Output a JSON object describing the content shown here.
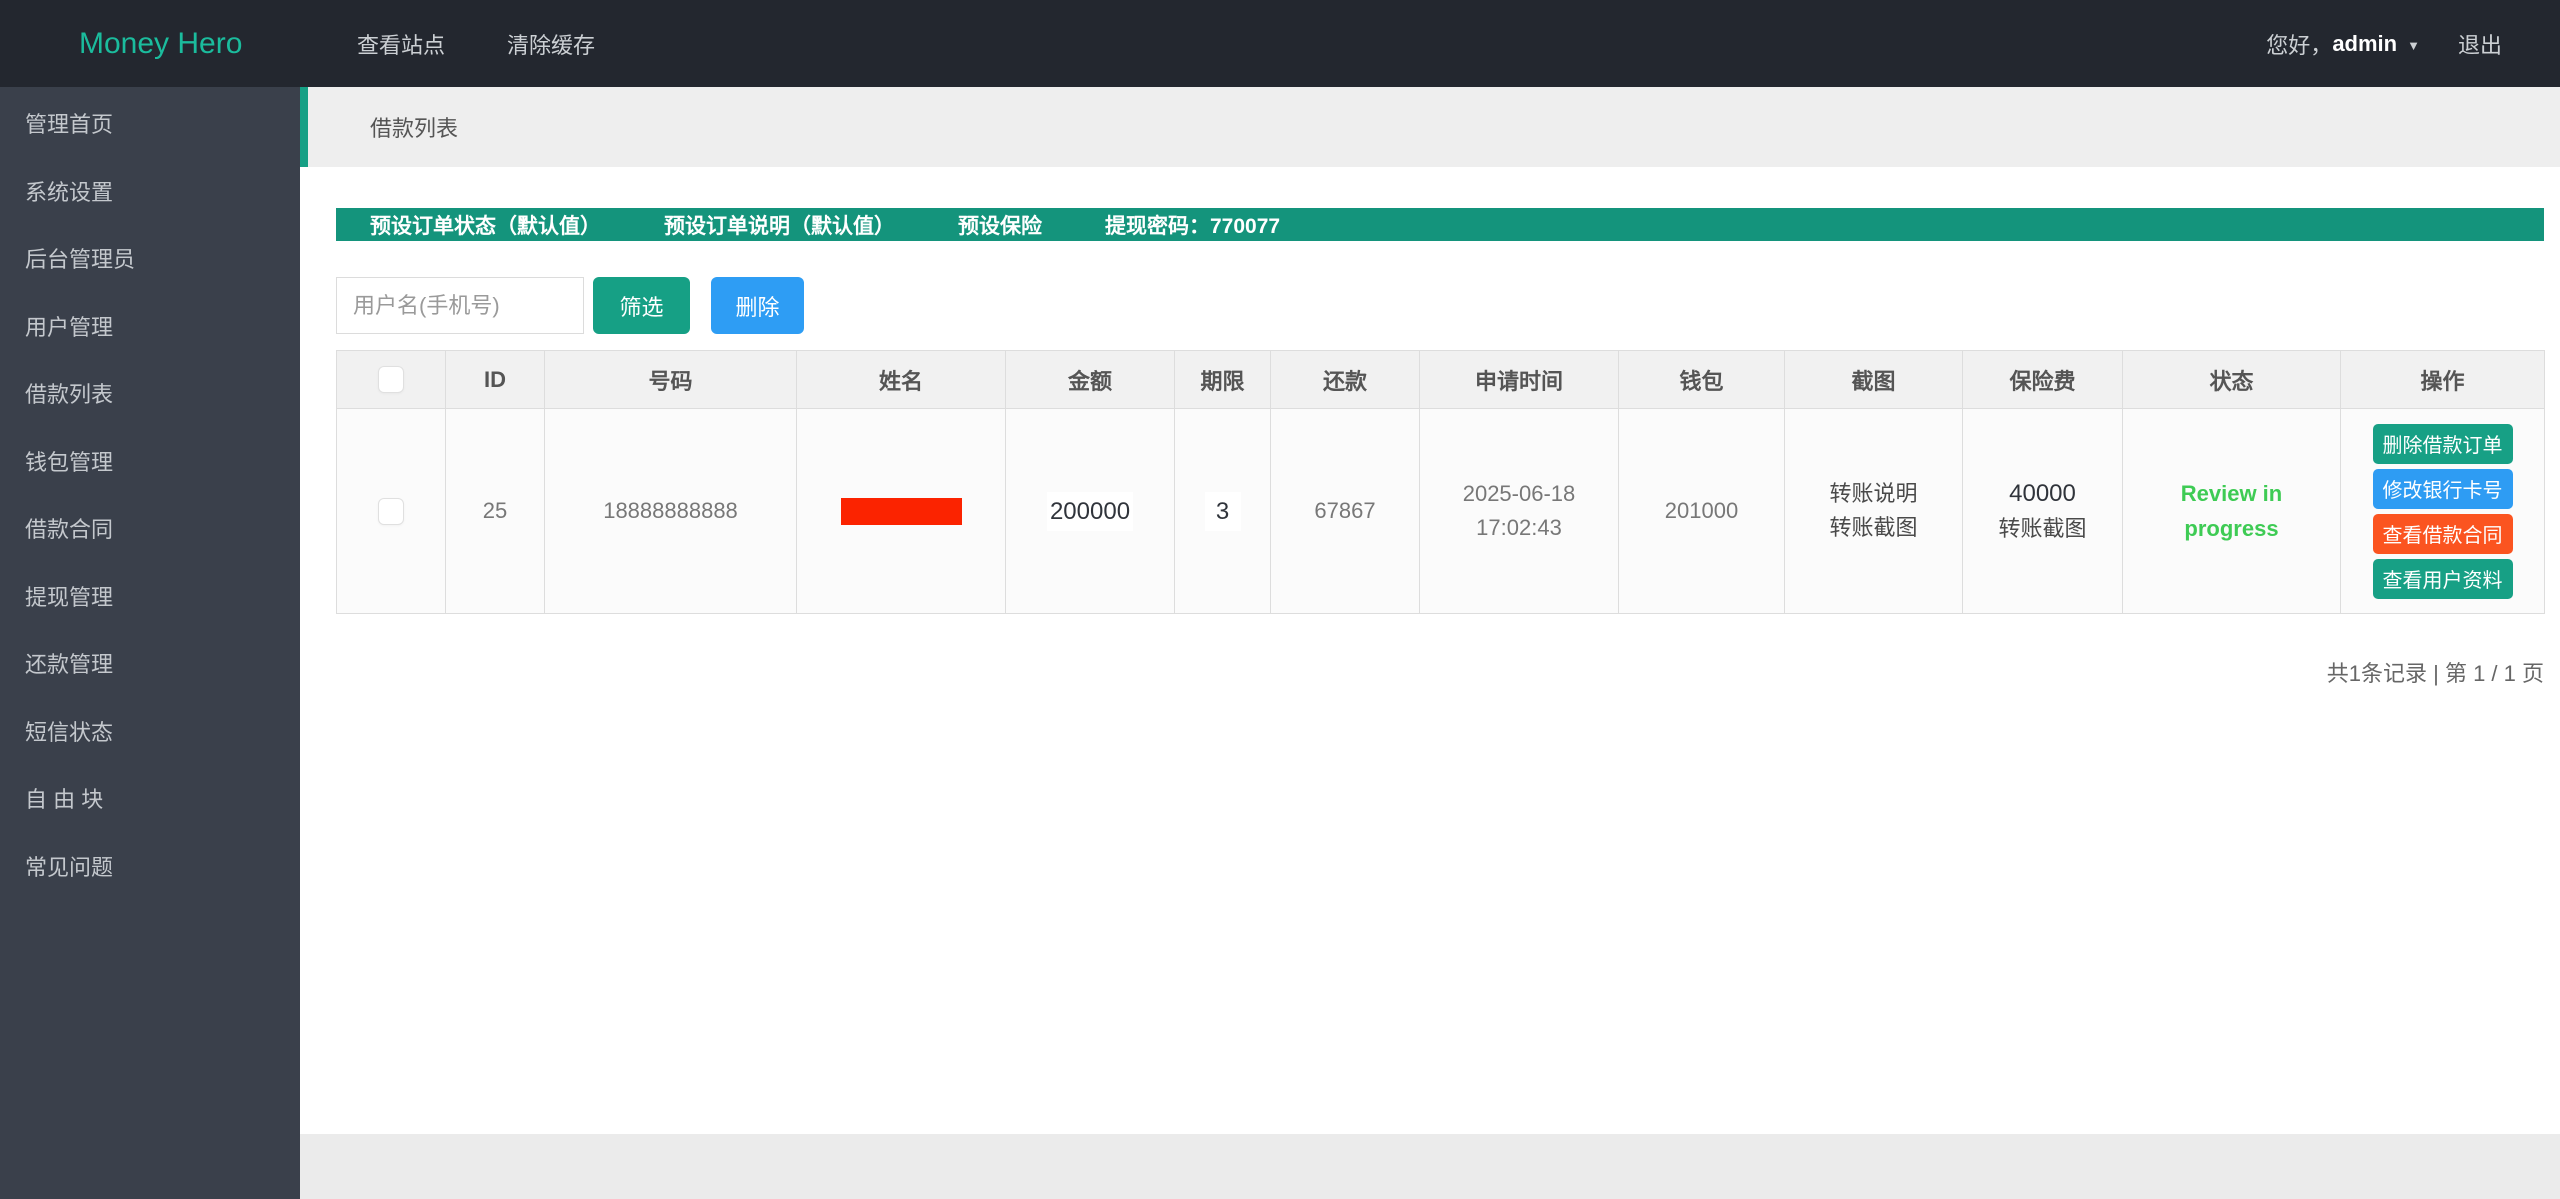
{
  "topbar": {
    "logo": "Money Hero",
    "menu": [
      {
        "label": "查看站点"
      },
      {
        "label": "清除缓存"
      }
    ],
    "greeting_prefix": "您好，",
    "username": "admin",
    "caret": "▼",
    "logout": "退出"
  },
  "sidebar": {
    "items": [
      "管理首页",
      "系统设置",
      "后台管理员",
      "用户管理",
      "借款列表",
      "钱包管理",
      "借款合同",
      "提现管理",
      "还款管理",
      "短信状态",
      "自 由 块",
      "常见问题"
    ]
  },
  "breadcrumb": {
    "title": "借款列表"
  },
  "presets": {
    "order_status": "预设订单状态（默认值）",
    "order_note": "预设订单说明（默认值）",
    "insurance": "预设保险",
    "withdraw_password": "提现密码：770077"
  },
  "search": {
    "placeholder": "用户名(手机号)",
    "filter_label": "筛选",
    "delete_label": "删除"
  },
  "table": {
    "headers": [
      "ID",
      "号码",
      "姓名",
      "金额",
      "期限",
      "还款",
      "申请时间",
      "钱包",
      "截图",
      "保险费",
      "状态",
      "操作"
    ],
    "row": {
      "id": "25",
      "phone": "18888888888",
      "amount": "200000",
      "term": "3",
      "repayment": "67867",
      "apply_date": "2025-06-18",
      "apply_time": "17:02:43",
      "wallet": "201000",
      "screenshot_link_1": "转账说明",
      "screenshot_link_2": "转账截图",
      "insurance_fee": "40000",
      "insurance_link": "转账截图",
      "status": "Review in progress",
      "actions": [
        {
          "label": "删除借款订单",
          "color": "#17a085"
        },
        {
          "label": "修改银行卡号",
          "color": "#2e9cf3"
        },
        {
          "label": "查看借款合同",
          "color": "#fb5420"
        },
        {
          "label": "查看用户资料",
          "color": "#17a085"
        }
      ]
    }
  },
  "pagination": {
    "text": "共1条记录 | 第 1 / 1 页"
  },
  "colors": {
    "topbar_bg": "#23272f",
    "sidebar_bg": "#3a404b",
    "accent_teal": "#16a085",
    "presets_bar_bg": "#14947c",
    "filter_btn": "#16a085",
    "delete_btn": "#2e9df4",
    "status_green": "#3ecb54",
    "redacted_red": "#fb2300",
    "logo_teal": "#1bbc9d"
  }
}
